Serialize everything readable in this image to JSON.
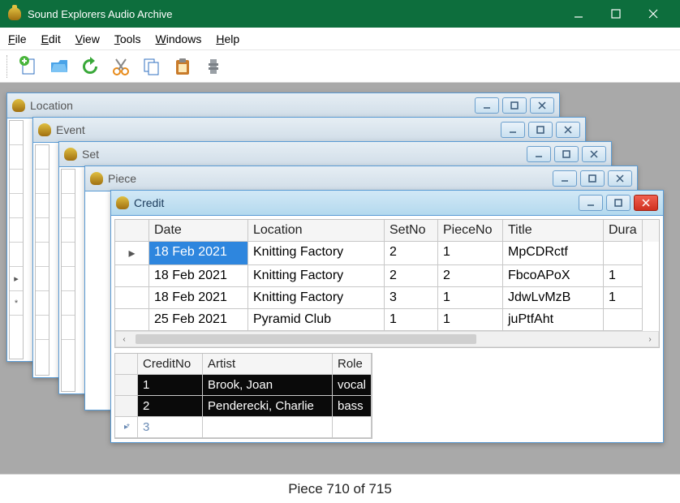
{
  "title": "Sound Explorers Audio Archive",
  "menu": {
    "file": "File",
    "edit": "Edit",
    "view": "View",
    "tools": "Tools",
    "windows": "Windows",
    "help": "Help"
  },
  "child_windows": [
    {
      "title": "Location"
    },
    {
      "title": "Event"
    },
    {
      "title": "Set"
    },
    {
      "title": "Piece"
    },
    {
      "title": "Credit"
    }
  ],
  "main_grid": {
    "columns": [
      "Date",
      "Location",
      "SetNo",
      "PieceNo",
      "Title",
      "Dura"
    ],
    "rows": [
      {
        "date": "18 Feb 2021",
        "location": "Knitting Factory",
        "set": "2",
        "piece": "1",
        "title": "MpCDRctf",
        "dur": ""
      },
      {
        "date": "18 Feb 2021",
        "location": "Knitting Factory",
        "set": "2",
        "piece": "2",
        "title": "FbcoAPoX",
        "dur": "1"
      },
      {
        "date": "18 Feb 2021",
        "location": "Knitting Factory",
        "set": "3",
        "piece": "1",
        "title": "JdwLvMzB",
        "dur": "1"
      },
      {
        "date": "25 Feb 2021",
        "location": "Pyramid Club",
        "set": "1",
        "piece": "1",
        "title": "juPtfAht",
        "dur": ""
      }
    ]
  },
  "sub_grid": {
    "columns": [
      "CreditNo",
      "Artist",
      "Role"
    ],
    "rows": [
      {
        "credit": "1",
        "artist": "Brook, Joan",
        "role": "vocal"
      },
      {
        "credit": "2",
        "artist": "Penderecki, Charlie",
        "role": "bass"
      }
    ],
    "new_row_credit": "3"
  },
  "status": "Piece 710 of 715"
}
